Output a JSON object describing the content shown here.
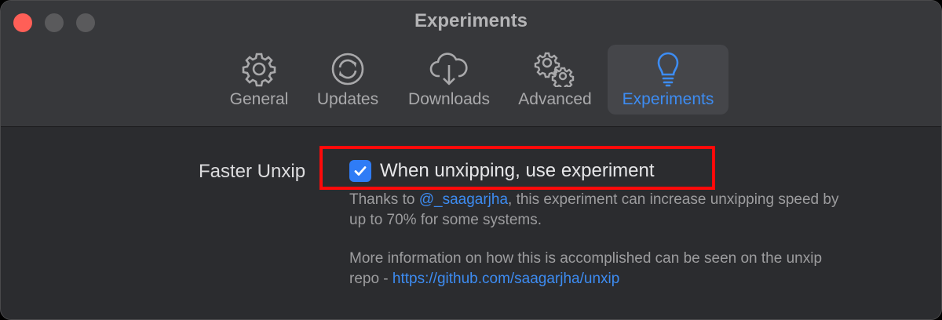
{
  "window": {
    "title": "Experiments",
    "controls": [
      "close",
      "minimize",
      "maximize"
    ]
  },
  "toolbar": {
    "tabs": [
      {
        "label": "General",
        "icon": "gear-icon",
        "active": false
      },
      {
        "label": "Updates",
        "icon": "refresh-icon",
        "active": false
      },
      {
        "label": "Downloads",
        "icon": "cloud-download-icon",
        "active": false
      },
      {
        "label": "Advanced",
        "icon": "gears-icon",
        "active": false
      },
      {
        "label": "Experiments",
        "icon": "lightbulb-icon",
        "active": true
      }
    ]
  },
  "setting": {
    "label": "Faster Unxip",
    "checkbox_label": "When unxipping, use experiment",
    "checked": true,
    "desc1_prefix": "Thanks to ",
    "desc1_link": "@_saagarjha",
    "desc1_suffix_line1": ", this experiment can increase unxipping speed by",
    "desc1_line2": "up to 70% for some systems.",
    "desc2_line1": "More information on how this is accomplished can be seen on the unxip",
    "desc2_prefix": "repo - ",
    "desc2_link": "https://github.com/saagarjha/unxip"
  },
  "colors": {
    "accent": "#3d8cf2",
    "highlight_box": "#ff0a0a",
    "close": "#ff5f57"
  }
}
